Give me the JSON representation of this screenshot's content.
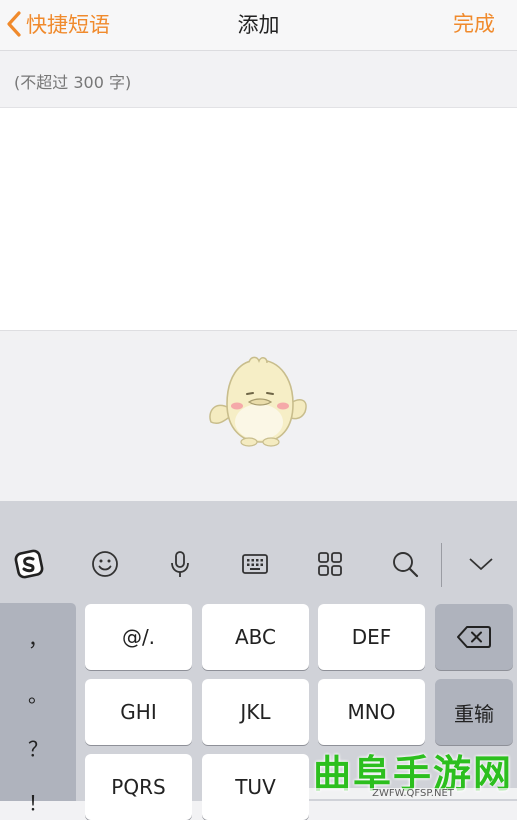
{
  "navbar": {
    "back_label": "快捷短语",
    "title": "添加",
    "done_label": "完成"
  },
  "editor": {
    "hint": "(不超过 300 字)",
    "text": ""
  },
  "keyboard": {
    "toolbar_icons": [
      "sogou-logo-icon",
      "emoji-icon",
      "microphone-icon",
      "keyboard-icon",
      "grid-icon",
      "search-icon",
      "collapse-icon"
    ],
    "symbols": [
      "，",
      "。",
      "？",
      "！"
    ],
    "keys": {
      "row1": [
        "@/.",
        "ABC",
        "DEF"
      ],
      "row2": [
        "GHI",
        "JKL",
        "MNO"
      ],
      "row3": [
        "PQRS",
        "TUV"
      ],
      "retype_label": "重输"
    }
  },
  "watermark": {
    "text": "曲阜手游网",
    "url": "ZWFW.QFSP.NET"
  },
  "colors": {
    "accent": "#f08a2c",
    "keyboard_bg": "#d0d2d8",
    "key_bg": "#ffffff",
    "func_key_bg": "#afb3bd",
    "watermark_green": "#2cbf1e"
  }
}
